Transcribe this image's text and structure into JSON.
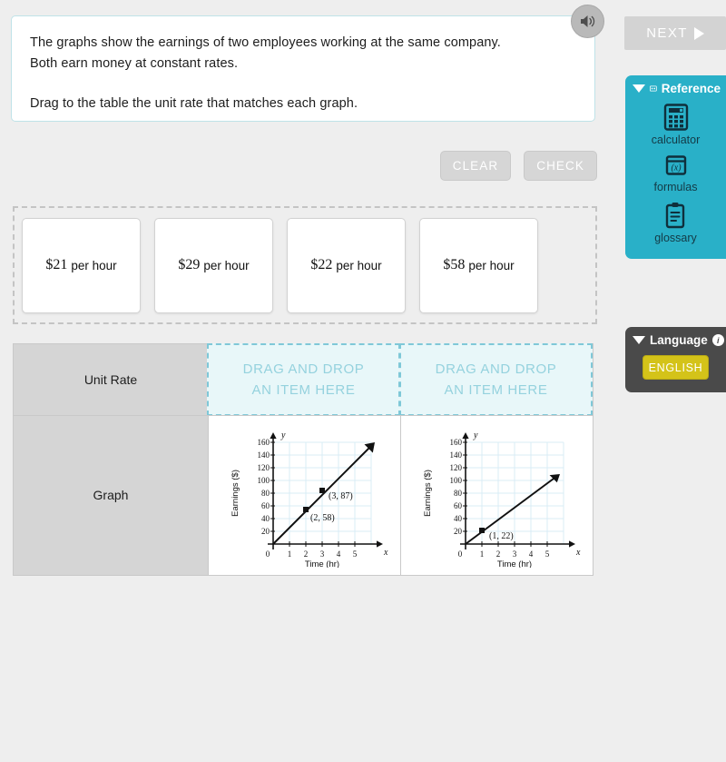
{
  "prompt": {
    "line1": "The graphs show the earnings of two employees working at the same company.",
    "line2": "Both earn money at constant rates.",
    "line3": "Drag to the table the unit rate that matches each graph.",
    "audio_icon": "speaker-icon"
  },
  "actions": {
    "clear_label": "CLEAR",
    "check_label": "CHECK"
  },
  "tray": {
    "tiles": [
      {
        "amount": "$21",
        "unit": "per hour"
      },
      {
        "amount": "$29",
        "unit": "per hour"
      },
      {
        "amount": "$22",
        "unit": "per hour"
      },
      {
        "amount": "$58",
        "unit": "per hour"
      }
    ]
  },
  "table": {
    "row_labels": {
      "unit_rate": "Unit Rate",
      "graph": "Graph"
    },
    "dropzone_text_line1": "DRAG AND DROP",
    "dropzone_text_line2": "AN ITEM HERE",
    "dropzones": [
      {
        "value": "",
        "filled": false
      },
      {
        "value": "",
        "filled": false
      }
    ]
  },
  "rail": {
    "next_label": "NEXT",
    "next_icon": "triangle-right-icon",
    "reference": {
      "title": "Reference",
      "collapse_icon": "triangle-down-icon",
      "header_icon": "reference-book-icon",
      "items": [
        {
          "label": "calculator",
          "icon": "calculator-icon"
        },
        {
          "label": "formulas",
          "icon": "formulas-icon"
        },
        {
          "label": "glossary",
          "icon": "clipboard-icon"
        }
      ]
    },
    "language": {
      "title": "Language",
      "collapse_icon": "triangle-down-icon",
      "info_icon": "info-icon",
      "info_glyph": "i",
      "selected": "ENGLISH"
    }
  },
  "colors": {
    "background": "#eeeeee",
    "prompt_border": "#bfe3e8",
    "reference_panel": "#29b0c8",
    "language_panel": "#4a4a4a",
    "language_button": "#d4c319",
    "dropzone_fill": "#e8f7f9",
    "dropzone_border": "#7fc8d8",
    "row_header": "#d5d5d5"
  },
  "chart_data": [
    {
      "type": "line",
      "title": "",
      "xlabel": "Time (hr)",
      "ylabel": "Earnings ($)",
      "x_axis_name": "x",
      "y_axis_name": "y",
      "xlim": [
        0,
        5.5
      ],
      "ylim": [
        0,
        170
      ],
      "xticks": [
        0,
        1,
        2,
        3,
        4,
        5
      ],
      "yticks": [
        20,
        40,
        60,
        80,
        100,
        120,
        140,
        160
      ],
      "grid": true,
      "slope": 29,
      "origin_label": "0",
      "points": [
        {
          "x": 2,
          "y": 58,
          "label": "(2, 58)"
        },
        {
          "x": 3,
          "y": 87,
          "label": "(3, 87)"
        }
      ],
      "line": {
        "x": [
          0,
          5.2
        ],
        "y": [
          0,
          150.8
        ]
      }
    },
    {
      "type": "line",
      "title": "",
      "xlabel": "Time (hr)",
      "ylabel": "Earnings ($)",
      "x_axis_name": "x",
      "y_axis_name": "y",
      "xlim": [
        0,
        5.5
      ],
      "ylim": [
        0,
        170
      ],
      "xticks": [
        0,
        1,
        2,
        3,
        4,
        5
      ],
      "yticks": [
        20,
        40,
        60,
        80,
        100,
        120,
        140,
        160
      ],
      "grid": true,
      "slope": 22,
      "origin_label": "0",
      "points": [
        {
          "x": 1,
          "y": 22,
          "label": "(1, 22)"
        }
      ],
      "line": {
        "x": [
          0,
          4.7
        ],
        "y": [
          0,
          103.4
        ]
      }
    }
  ]
}
